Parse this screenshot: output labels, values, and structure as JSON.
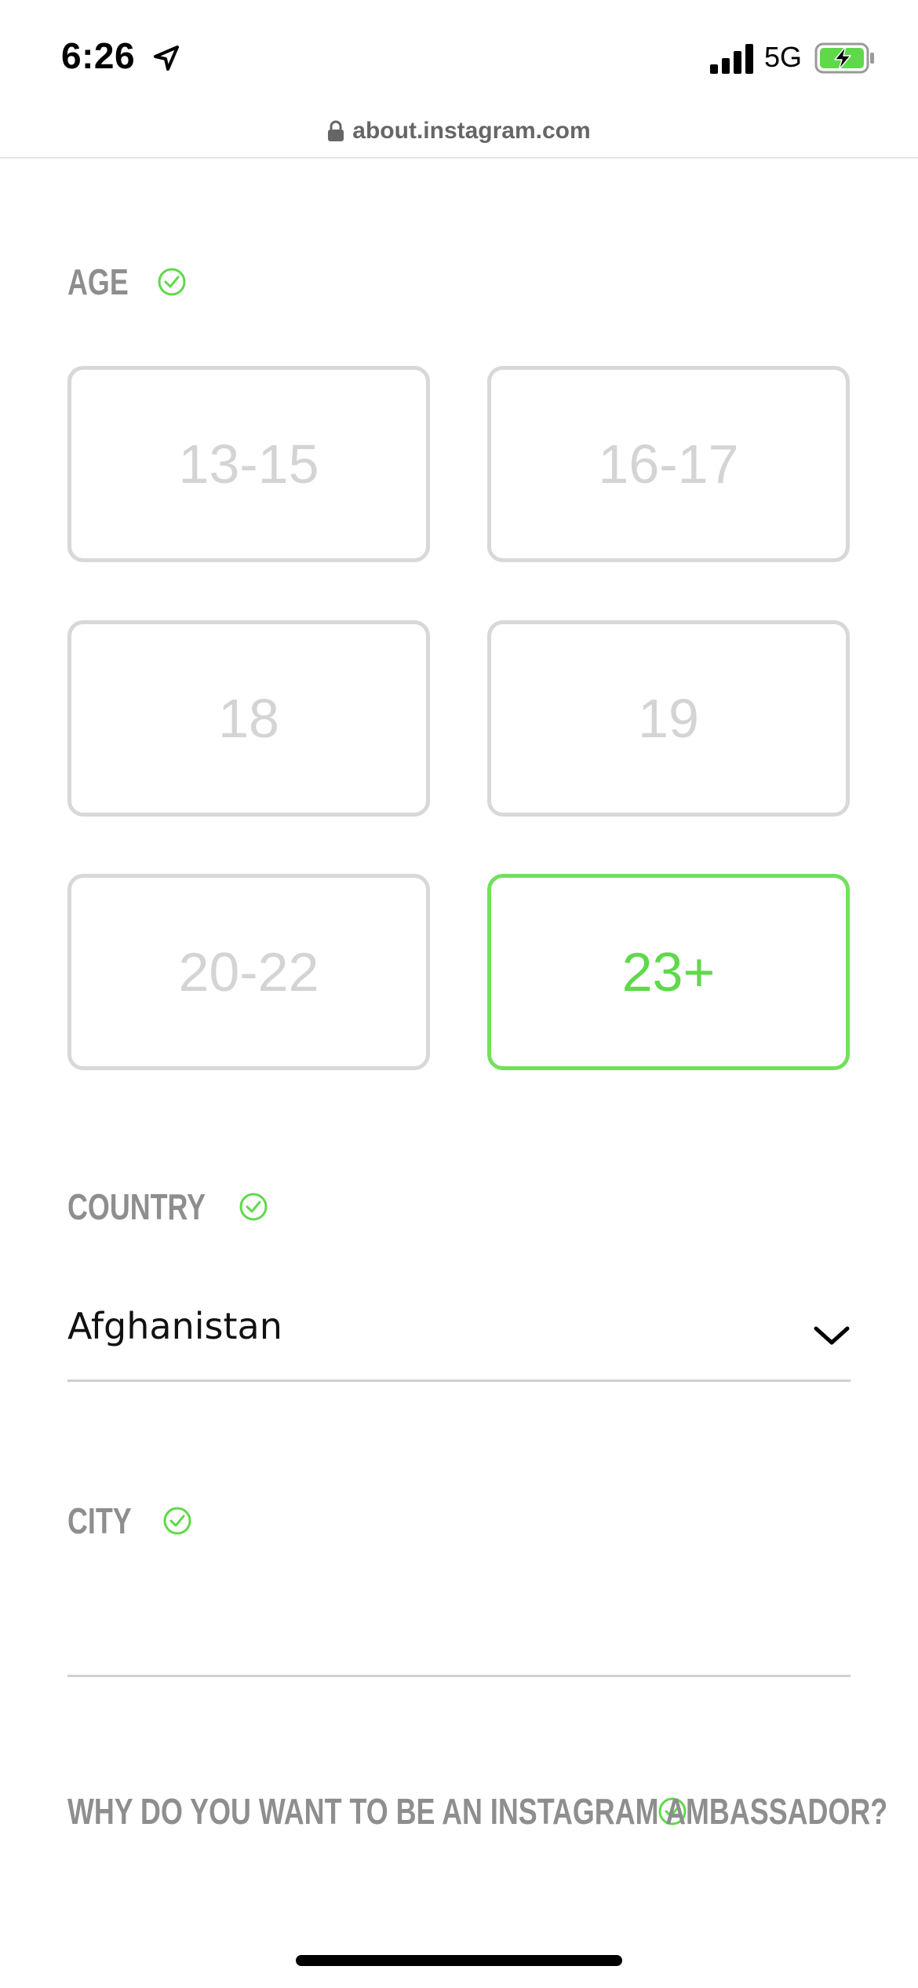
{
  "status_bar": {
    "time": "6:26",
    "network": "5G",
    "location_icon": "location-arrow-icon",
    "signal_icon": "cellular-signal-icon",
    "battery_icon": "battery-charging-icon"
  },
  "browser": {
    "url": "about.instagram.com",
    "lock_icon": "lock-icon"
  },
  "form": {
    "age": {
      "label": "AGE",
      "options": [
        "13-15",
        "16-17",
        "18",
        "19",
        "20-22",
        "23+"
      ],
      "selected": "23+"
    },
    "country": {
      "label": "COUNTRY",
      "value": "Afghanistan",
      "dropdown_icon": "chevron-down-icon"
    },
    "city": {
      "label": "CITY",
      "value": ""
    },
    "why": {
      "label": "WHY DO YOU WANT TO BE AN INSTAGRAM AMBASSADOR?"
    },
    "valid_icon": "check-circle-icon"
  },
  "colors": {
    "accent_green": "#5fd94a",
    "label_gray": "#8e8e8e",
    "border_gray": "#d8d8d8"
  }
}
